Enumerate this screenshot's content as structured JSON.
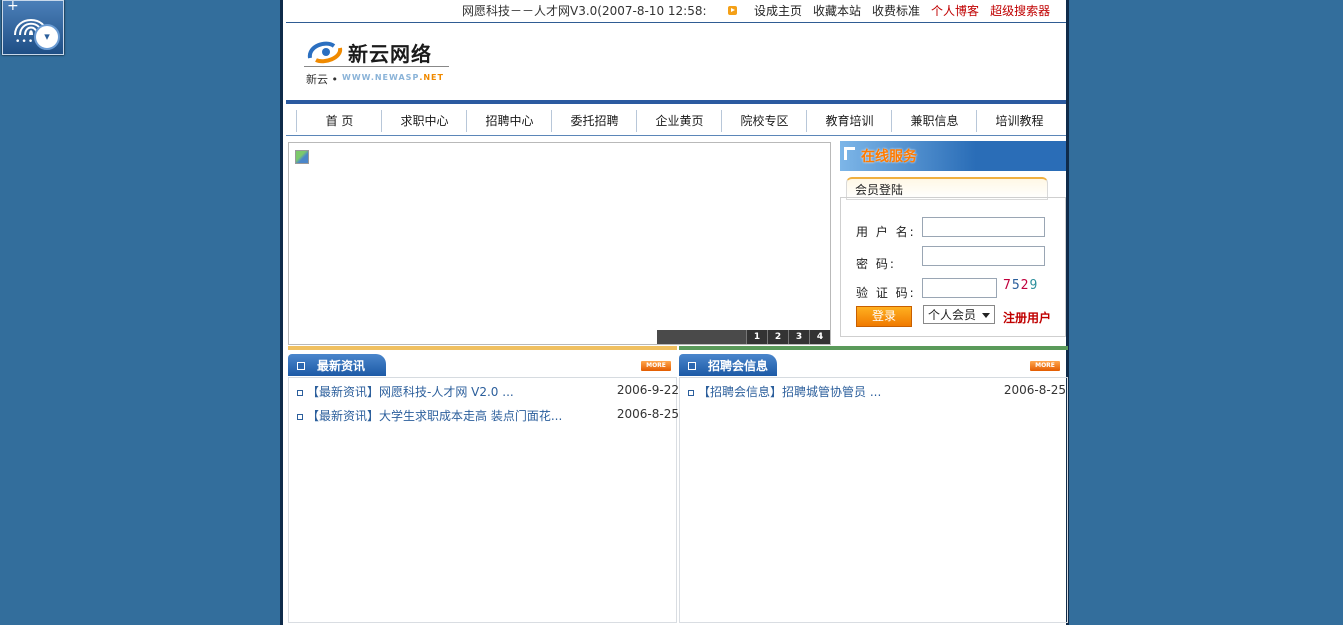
{
  "desktop": {
    "gadget_icon": "fingerprint-gadget-icon",
    "gadget_plus": "+",
    "gadget_dots": "••••",
    "gadget_badge": "▾"
  },
  "topbar": {
    "ticker": "网愿科技－－人才网V3.0(2007-8-10 12:58:",
    "links": [
      "设成主页",
      "收藏本站",
      "收费标准",
      "个人博客",
      "超级搜索器"
    ]
  },
  "logo": {
    "name": "新云网络",
    "sub": "新云 •",
    "url_main": "WWW.NEWASP",
    "url_ext": ".NET"
  },
  "nav": [
    "首  页",
    "求职中心",
    "招聘中心",
    "委托招聘",
    "企业黄页",
    "院校专区",
    "教育培训",
    "兼职信息",
    "培训教程"
  ],
  "banner": {
    "slides": [
      "1",
      "2",
      "3",
      "4"
    ]
  },
  "service": {
    "title": "在线服务",
    "tab": "会员登陆",
    "username_label": "用 户 名:",
    "password_label": "密     码:",
    "captcha_label": "验 证 码:",
    "captcha": [
      "7",
      "5",
      "2",
      "9"
    ],
    "captcha_colors": [
      "#c0003c",
      "#2c5f9c",
      "#c0003c",
      "#2c8f9c"
    ],
    "login_button": "登录",
    "member_type": "个人会员",
    "register": "注册用户"
  },
  "news": {
    "title": "最新资讯",
    "more": "MORE",
    "items": [
      {
        "text": "【最新资讯】网愿科技-人才网 V2.0 ...",
        "date": "2006-9-22"
      },
      {
        "text": "【最新资讯】大学生求职成本走高 装点门面花...",
        "date": "2006-8-25"
      }
    ]
  },
  "fairs": {
    "title": "招聘会信息",
    "more": "MORE",
    "items": [
      {
        "text": "【招聘会信息】招聘城管协管员 ...",
        "date": "2006-8-25"
      }
    ]
  },
  "colors": {
    "desktop_bg": "#336e9c",
    "accent_blue": "#2b5aa0",
    "news_bar": "#f0c060",
    "fairs_bar": "#5a9a5a",
    "link": "#2c5f9c",
    "red": "#c00000",
    "orange": "#ff7a00"
  }
}
